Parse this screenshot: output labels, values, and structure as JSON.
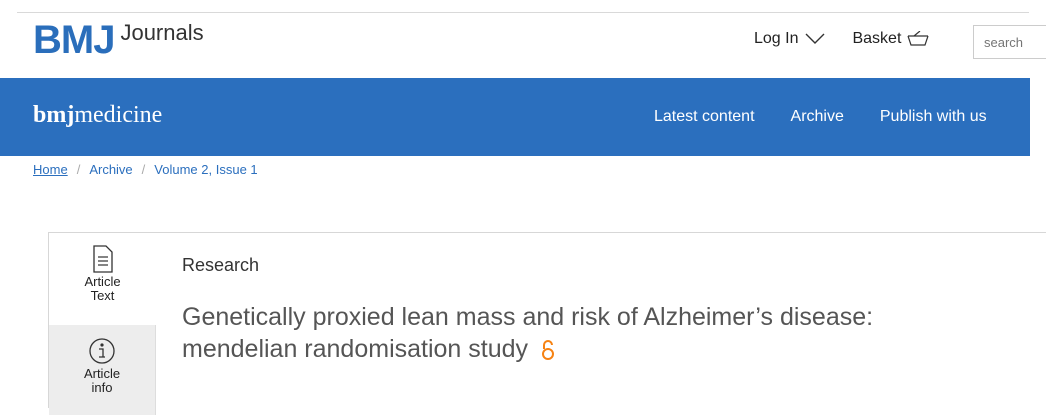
{
  "header": {
    "logo_mark": "BMJ",
    "logo_text": "Journals",
    "login_label": "Log In",
    "basket_label": "Basket",
    "search_placeholder": "search"
  },
  "navbar": {
    "brand_bold": "bmj",
    "brand_rest": "medicine",
    "items": [
      {
        "label": "Latest content"
      },
      {
        "label": "Archive"
      },
      {
        "label": "Publish with us"
      }
    ]
  },
  "breadcrumb": {
    "home": "Home",
    "archive": "Archive",
    "issue": "Volume 2, Issue 1",
    "separator": "/"
  },
  "side_tabs": [
    {
      "label_line1": "Article",
      "label_line2": "Text",
      "icon": "document-icon"
    },
    {
      "label_line1": "Article",
      "label_line2": "info",
      "icon": "info-icon"
    }
  ],
  "article": {
    "type": "Research",
    "title_line1": "Genetically proxied lean mass and risk of Alzheimer’s disease:",
    "title_line2": "mendelian randomisation study",
    "open_access_icon": "open-access-icon"
  },
  "colors": {
    "brand_blue": "#2b6fbe",
    "open_access_orange": "#f68212"
  }
}
